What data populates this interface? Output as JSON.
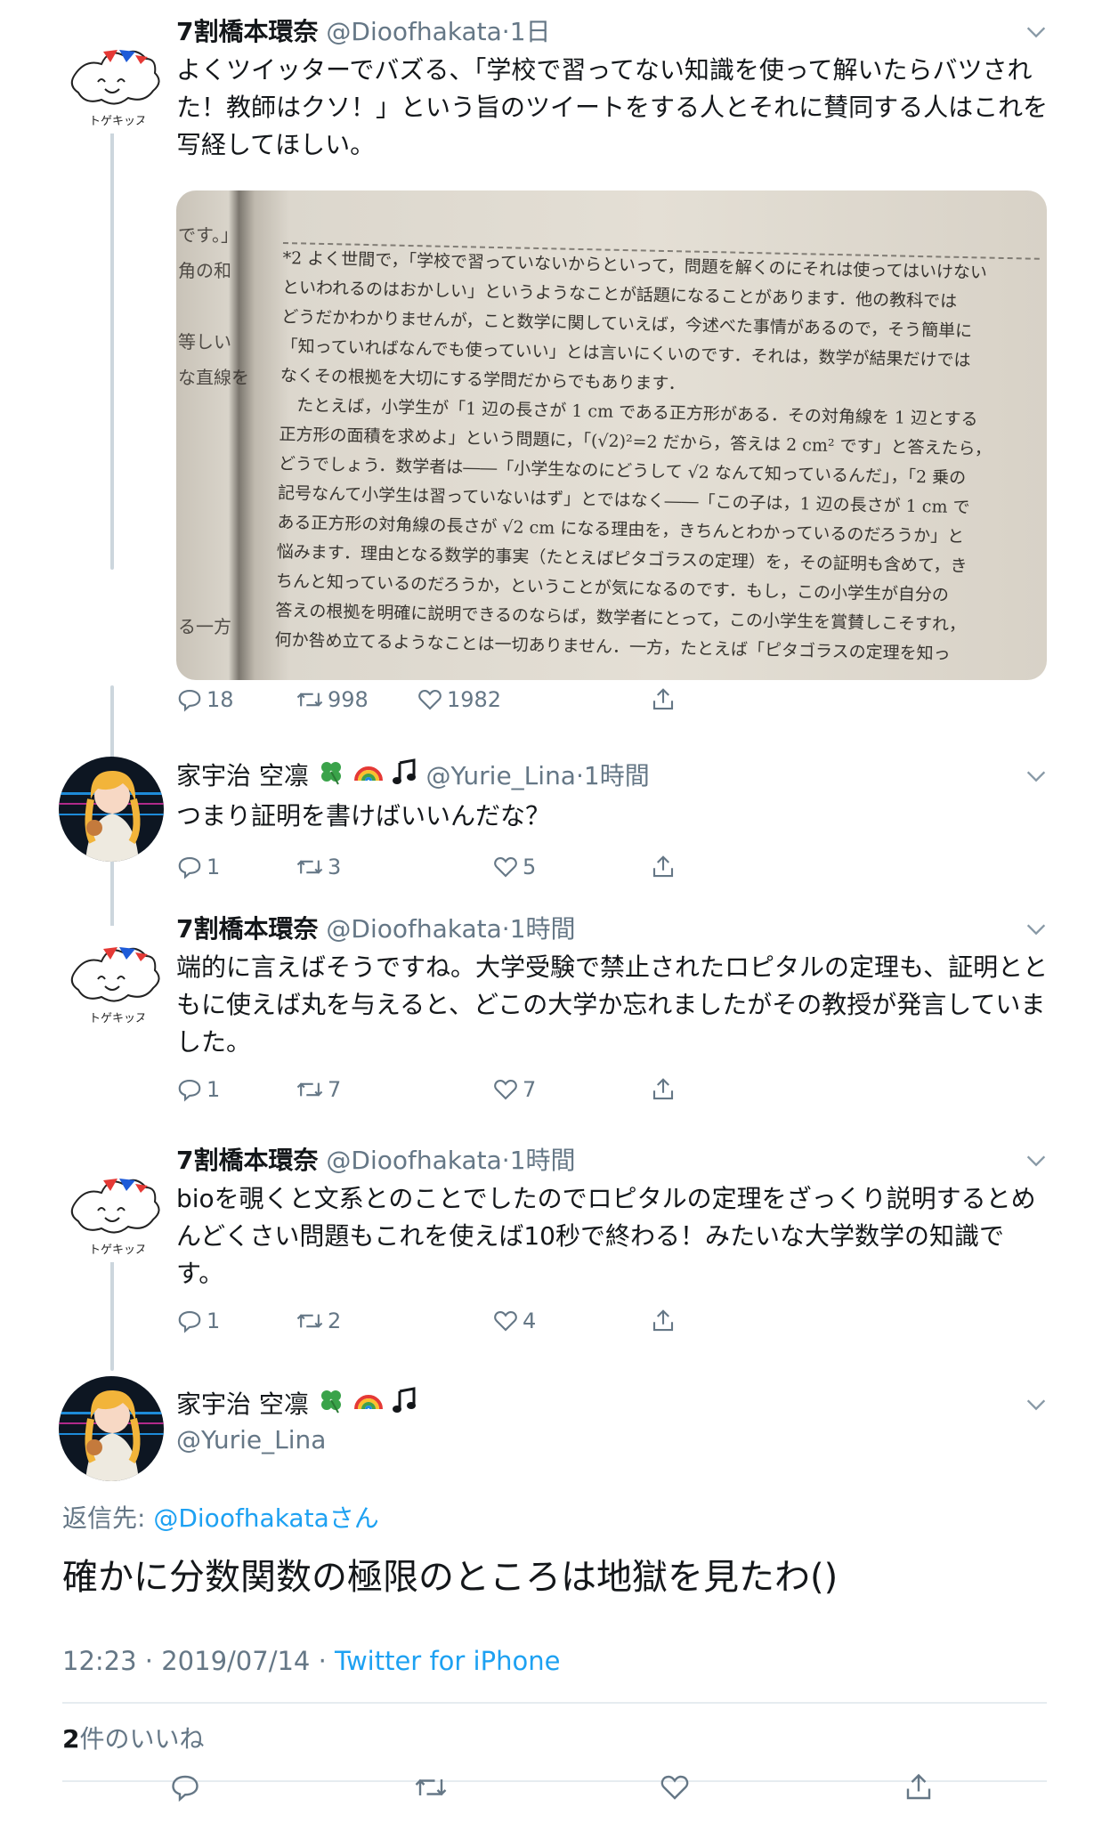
{
  "colors": {
    "text": "#14171a",
    "secondary": "#657786",
    "link": "#1da1f2",
    "thread_line": "#ccd6dd",
    "divider": "#e6ecf0",
    "clover": "#3aa34a"
  },
  "tweets": [
    {
      "name": "7割橋本環奈",
      "handle": "@Dioofhakata",
      "sep": "·",
      "time": "1日",
      "text": "よくツイッターでバズる、「学校で習ってない知識を使って解いたらバツされた！教師はクソ！」という旨のツイートをする人とそれに賛同する人はこれを写経してほしい。",
      "replies": "18",
      "retweets": "998",
      "likes": "1982"
    },
    {
      "name": "家宇治 空凛",
      "handle": "@Yurie_Lina",
      "sep": "·",
      "time": "1時間",
      "text": "つまり証明を書けばいいんだな？",
      "replies": "1",
      "retweets": "3",
      "likes": "5"
    },
    {
      "name": "7割橋本環奈",
      "handle": "@Dioofhakata",
      "sep": "·",
      "time": "1時間",
      "text": "端的に言えばそうですね。大学受験で禁止されたロピタルの定理も、証明とともに使えば丸を与えると、どこの大学か忘れましたがその教授が発言していました。",
      "replies": "1",
      "retweets": "7",
      "likes": "7"
    },
    {
      "name": "7割橋本環奈",
      "handle": "@Dioofhakata",
      "sep": "·",
      "time": "1時間",
      "text": "bioを覗くと文系とのことでしたのでロピタルの定理をざっくり説明するとめんどくさい問題もこれを使えば10秒で終わる！みたいな大学数学の知識です。",
      "replies": "1",
      "retweets": "2",
      "likes": "4"
    }
  ],
  "avatar_a": {
    "caption": "トゲキッス"
  },
  "photo": {
    "left_column": "です。」\n角の和\n\n等しい\nな直線を\n\n\n\n\n\n\nる一方",
    "text": "*2 よく世間で，「学校で習っていないからといって，問題を解くのにそれは使ってはいけない\nといわれるのはおかしい」というようなことが話題になることがあります．他の教科では\nどうだかわかりませんが，こと数学に関していえば，今述べた事情があるので，そう簡単に\n「知っていればなんでも使っていい」とは言いにくいのです．それは，数学が結果だけでは\nなくその根拠を大切にする学問だからでもあります．\n　たとえば，小学生が「1 辺の長さが 1 cm である正方形がある．その対角線を 1 辺とする\n正方形の面積を求めよ」という問題に，「(√2)²=2 だから，答えは 2 cm² です」と答えたら，\nどうでしょう．数学者は――「小学生なのにどうして √2 なんて知っているんだ」，「2 乗の\n記号なんて小学生は習っていないはず」とではなく――「この子は，1 辺の長さが 1 cm で\nある正方形の対角線の長さが √2 cm になる理由を，きちんとわかっているのだろうか」と\n悩みます．理由となる数学的事実（たとえばピタゴラスの定理）を，その証明も含めて，き\nちんと知っているのだろうか，ということが気になるのです．もし，この小学生が自分の\n答えの根拠を明確に説明できるのならば，数学者にとって，この小学生を賞賛しこそすれ，\n何か咎め立てるようなことは一切ありません．一方，たとえば「ピタゴラスの定理を知っ"
  },
  "focus": {
    "name": "家宇治 空凛",
    "handle": "@Yurie_Lina",
    "reply_label": "返信先: ",
    "reply_mention": "@Dioofhakataさん",
    "text": "確かに分数関数の極限のところは地獄を見たわ()",
    "time": "12:23 · 2019/07/14 · ",
    "source": "Twitter for iPhone",
    "likes_count": "2",
    "likes_label": "件のいいね"
  }
}
